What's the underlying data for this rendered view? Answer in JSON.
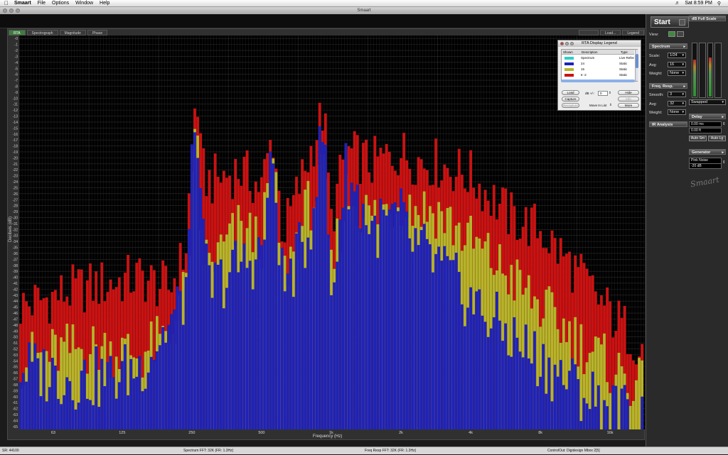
{
  "menubar": {
    "app_name": "Smaart",
    "items": [
      "File",
      "Options",
      "Window",
      "Help"
    ],
    "clock": "Sat 8:59 PM"
  },
  "window": {
    "title": "Smaart"
  },
  "tabs": [
    {
      "label": "RTA",
      "active": true
    },
    {
      "label": "Spectrograph",
      "active": false
    },
    {
      "label": "Magnitude",
      "active": false
    },
    {
      "label": "Phase",
      "active": false
    }
  ],
  "plot_buttons": {
    "load": "Load...",
    "legend": "Legend"
  },
  "plot": {
    "ylabel": "Decibels (dB)",
    "xlabel": "Frequency (Hz)"
  },
  "chart_data": {
    "type": "bar",
    "xlabel": "Frequency (Hz)",
    "ylabel": "Decibels (dB)",
    "xscale": "log",
    "xticks": [
      "63",
      "125",
      "250",
      "500",
      "1k",
      "2k",
      "4k",
      "8k",
      "16k"
    ],
    "yticks": [
      "-0",
      "-1",
      "-2",
      "-3",
      "-4",
      "-5",
      "-6",
      "-7",
      "-8",
      "-9",
      "-10",
      "-11",
      "-12",
      "-13",
      "-14",
      "-15",
      "-16",
      "-17",
      "-18",
      "-19",
      "-20",
      "-21",
      "-22",
      "-23",
      "-24",
      "-25",
      "-26",
      "-27",
      "-28",
      "-29",
      "-30",
      "-31",
      "-32",
      "-33",
      "-34",
      "-35",
      "-36",
      "-37",
      "-38",
      "-39",
      "-40",
      "-41",
      "-42",
      "-43",
      "-44",
      "-45",
      "-46",
      "-47",
      "-48",
      "-49",
      "-50",
      "-51",
      "-52",
      "-53",
      "-54",
      "-55",
      "-56",
      "-57",
      "-58",
      "-59",
      "-60",
      "-61",
      "-62",
      "-63",
      "-64",
      "-65"
    ],
    "ylim": [
      -65.5,
      0.5
    ],
    "xlim": [
      44.9,
      22600
    ],
    "grid": true,
    "bands_per_octave": 24,
    "anchor_x": [
      44.9,
      80,
      110,
      150,
      200,
      235,
      262,
      275,
      300,
      400,
      500,
      560,
      620,
      800,
      930,
      1000,
      1150,
      1500,
      2000,
      2200,
      2900,
      4000,
      6000,
      8000,
      12000,
      16000,
      22600
    ],
    "series": [
      {
        "name": "6 -2",
        "color": "#cc1111",
        "values": [
          -45,
          -42,
          -41,
          -40,
          -42,
          -36,
          -7.5,
          -22,
          -24,
          -22,
          -25,
          -16,
          -33,
          -20,
          -12,
          -31,
          -19,
          -21,
          -19,
          -20,
          -21,
          -23,
          -30,
          -32,
          -40,
          -46,
          -52
        ]
      },
      {
        "name": "15",
        "color": "#b5b52a",
        "values": [
          -54,
          -52,
          -52,
          -53,
          -50,
          -42,
          -15,
          -35,
          -38,
          -32,
          -34,
          -21,
          -40,
          -28,
          -24,
          -40,
          -26,
          -30,
          -27,
          -28,
          -29,
          -34,
          -40,
          -45,
          -51,
          -55,
          -59
        ]
      },
      {
        "name": "24",
        "color": "#1e22b8",
        "values": [
          -55,
          -57,
          -57,
          -55,
          -48,
          -43,
          -9,
          -33,
          -42,
          -38,
          -36,
          -20,
          -42,
          -33,
          -14,
          -44,
          -22,
          -32,
          -30,
          -34,
          -38,
          -44,
          -50,
          -54,
          -59,
          -62,
          -64
        ]
      }
    ]
  },
  "legend_window": {
    "title": "RTA Display Legend",
    "columns": [
      "Shown",
      "Description",
      "Type"
    ],
    "rows": [
      {
        "color": "#2ed0c8",
        "description": "Spectrum",
        "type": "Live Referen"
      },
      {
        "color": "#1e22b8",
        "description": "24",
        "type": "Static"
      },
      {
        "color": "#b5b52a",
        "description": "15",
        "type": "Static"
      },
      {
        "color": "#cc1111",
        "description": "6 -2",
        "type": "Static"
      }
    ],
    "buttons": {
      "load": "Load",
      "capture": "Capture",
      "recapture": "Recapture",
      "hide": "Hide",
      "info": "Info",
      "more": "More"
    },
    "db_label": "dB +/-:",
    "db_value": "0",
    "move_label": "Move In List"
  },
  "panel": {
    "start": "Start",
    "view_label": "View:",
    "spectrum_header": "Spectrum",
    "scale_label": "Scale:",
    "scale_value": "1/24",
    "avg_label": "Avg:",
    "avg_value": "16",
    "weight_label": "Weight:",
    "weight_value": "None",
    "freq_header": "Freq. Resp.",
    "smooth_label": "Smooth:",
    "smooth_value": "3",
    "fr_avg_label": "Avg:",
    "fr_avg_value": "32",
    "fr_weight_label": "Weight:",
    "fr_weight_value": "None",
    "ir_header": "IR Analysis",
    "dbfs_header": "dB Full Scale",
    "swapped": "Swapped",
    "delay_header": "Delay",
    "delay_ms": "0.00 ms",
    "delay_ft": "0.00 ft",
    "auto_sm": "Auto Sm",
    "auto_lg": "Auto Lg",
    "generator_header": "Generator",
    "generator_type": "Pink Noise",
    "generator_level": "-20 dB",
    "logo": "Smaart"
  },
  "statusbar": {
    "sr": "SR: 44100",
    "spectrum_fft": "Spectrum FFT: 32K (FR: 1.3Hz)",
    "freq_resp_fft": "Freq Resp FFT: 32K (FR: 1.3Hz)",
    "io": "ControlOut: Digidesign Mbox 2[5]"
  }
}
